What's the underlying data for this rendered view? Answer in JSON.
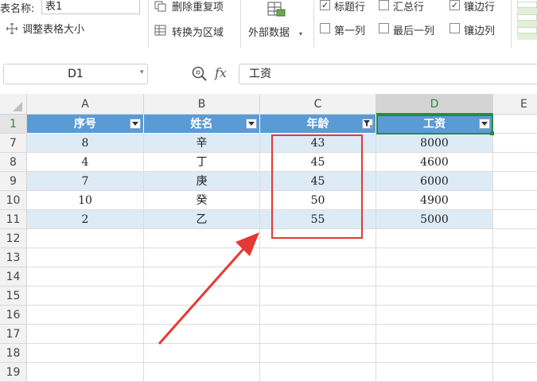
{
  "ribbon": {
    "table_name_label": "表名称:",
    "table_name_value": "表1",
    "resize_table": "调整表格大小",
    "remove_duplicates": "删除重复项",
    "convert_to_range": "转换为区域",
    "external_data": "外部数据",
    "header_row": "标题行",
    "total_row": "汇总行",
    "banded_rows": "镶边行",
    "first_column": "第一列",
    "last_column": "最后一列",
    "banded_columns": "镶边列",
    "checked_mark": "✓"
  },
  "formula_bar": {
    "name_box": "D1",
    "fx": "fx",
    "content": "工资"
  },
  "columns": [
    "A",
    "B",
    "C",
    "D",
    "E"
  ],
  "row_numbers": [
    "1",
    "7",
    "8",
    "9",
    "10",
    "11",
    "12",
    "13",
    "14",
    "15",
    "16",
    "17",
    "18",
    "19"
  ],
  "table": {
    "headers": [
      "序号",
      "姓名",
      "年龄",
      "工资"
    ],
    "rows": [
      [
        "8",
        "辛",
        "43",
        "8000"
      ],
      [
        "4",
        "丁",
        "45",
        "4600"
      ],
      [
        "7",
        "庚",
        "45",
        "6000"
      ],
      [
        "10",
        "癸",
        "50",
        "4900"
      ],
      [
        "2",
        "乙",
        "55",
        "5000"
      ]
    ]
  },
  "colors": {
    "header_fill": "#5b9bd5",
    "band_fill": "#ddebf7",
    "selection": "#2b8a3e",
    "annotation": "#e53935"
  }
}
